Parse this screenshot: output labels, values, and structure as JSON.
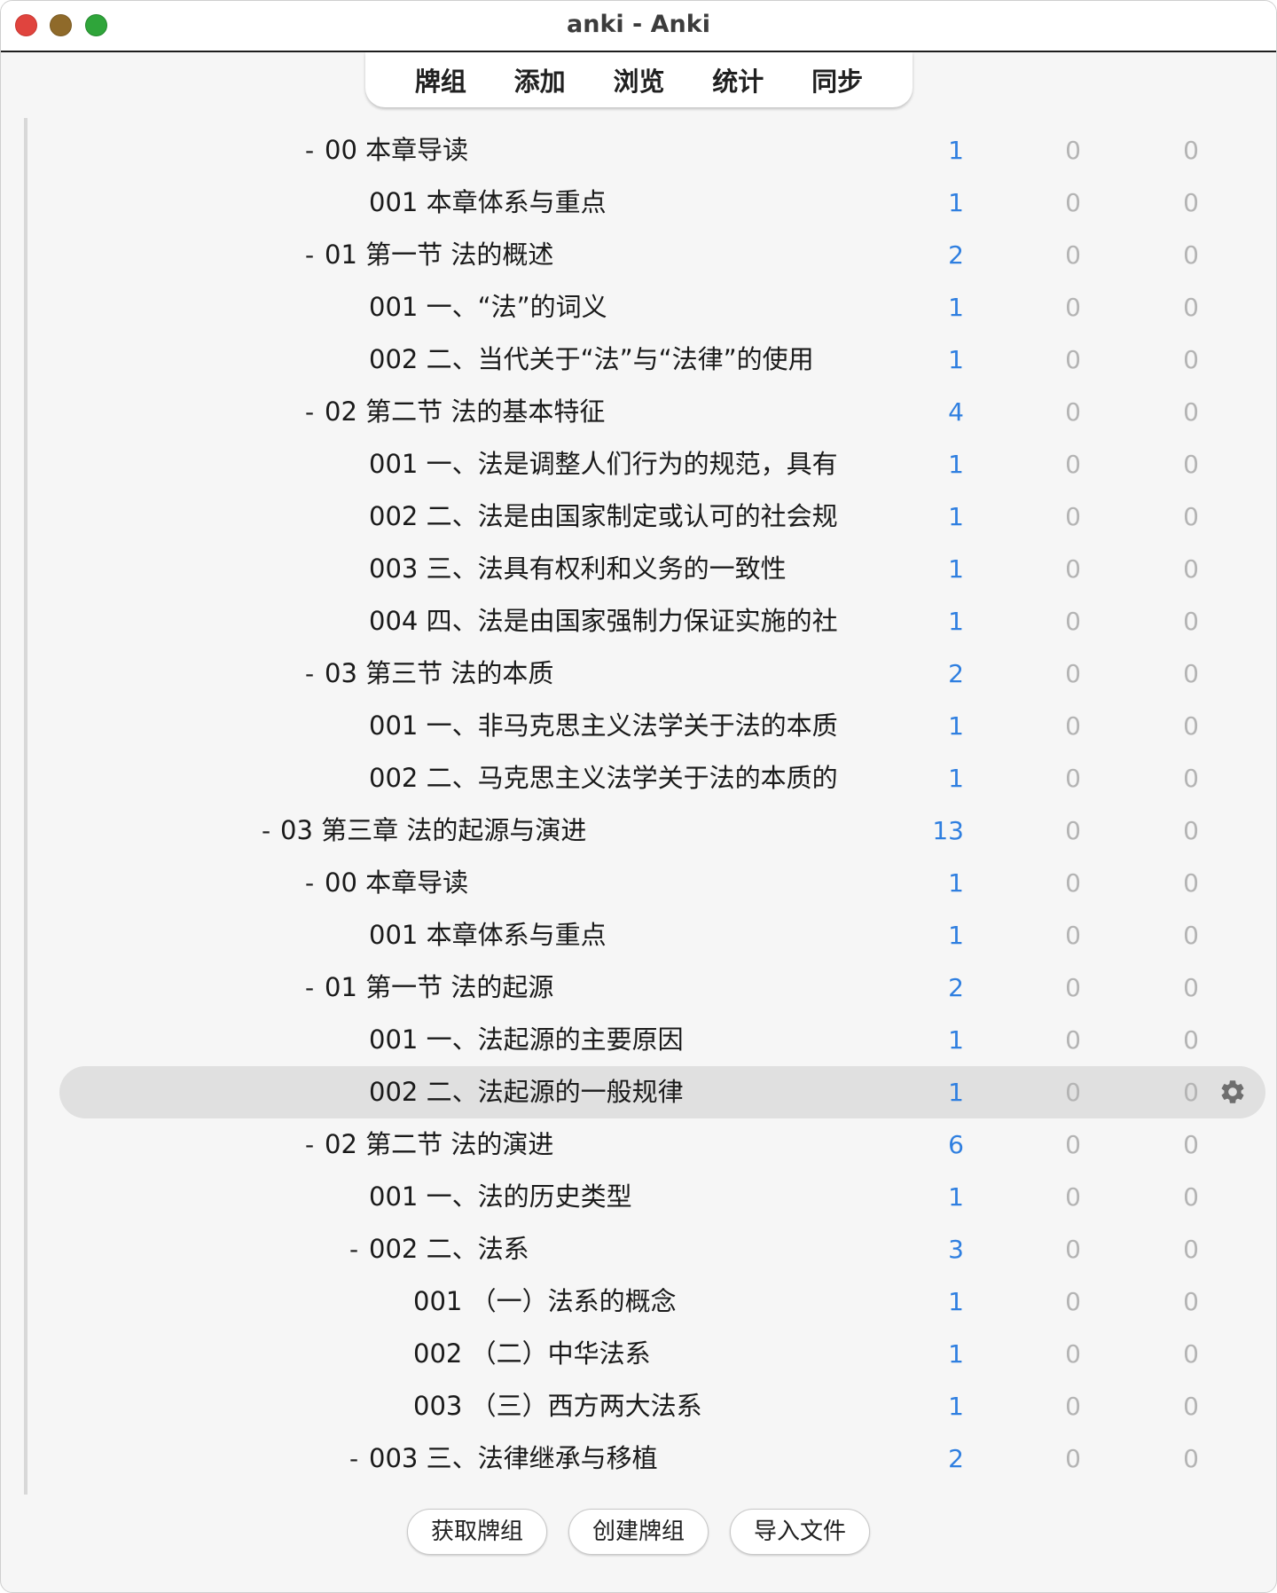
{
  "window": {
    "title": "anki - Anki"
  },
  "toolbar": {
    "tabs": [
      "牌组",
      "添加",
      "浏览",
      "统计",
      "同步"
    ]
  },
  "decks": [
    {
      "collapse": "-",
      "name": "00 本章导读",
      "level": 2,
      "new": "1",
      "learn": "0",
      "review": "0"
    },
    {
      "collapse": "",
      "name": "001 本章体系与重点",
      "level": 3,
      "new": "1",
      "learn": "0",
      "review": "0"
    },
    {
      "collapse": "-",
      "name": "01 第一节 法的概述",
      "level": 2,
      "new": "2",
      "learn": "0",
      "review": "0"
    },
    {
      "collapse": "",
      "name": "001 一、“法”的词义",
      "level": 3,
      "new": "1",
      "learn": "0",
      "review": "0"
    },
    {
      "collapse": "",
      "name": "002 二、当代关于“法”与“法律”的使用",
      "level": 3,
      "new": "1",
      "learn": "0",
      "review": "0"
    },
    {
      "collapse": "-",
      "name": "02 第二节 法的基本特征",
      "level": 2,
      "new": "4",
      "learn": "0",
      "review": "0"
    },
    {
      "collapse": "",
      "name": "001 一、法是调整人们行为的规范，具有",
      "level": 3,
      "new": "1",
      "learn": "0",
      "review": "0"
    },
    {
      "collapse": "",
      "name": "002 二、法是由国家制定或认可的社会规",
      "level": 3,
      "new": "1",
      "learn": "0",
      "review": "0"
    },
    {
      "collapse": "",
      "name": "003 三、法具有权利和义务的一致性",
      "level": 3,
      "new": "1",
      "learn": "0",
      "review": "0"
    },
    {
      "collapse": "",
      "name": "004 四、法是由国家强制力保证实施的社",
      "level": 3,
      "new": "1",
      "learn": "0",
      "review": "0"
    },
    {
      "collapse": "-",
      "name": "03 第三节 法的本质",
      "level": 2,
      "new": "2",
      "learn": "0",
      "review": "0"
    },
    {
      "collapse": "",
      "name": "001 一、非马克思主义法学关于法的本质",
      "level": 3,
      "new": "1",
      "learn": "0",
      "review": "0"
    },
    {
      "collapse": "",
      "name": "002 二、马克思主义法学关于法的本质的",
      "level": 3,
      "new": "1",
      "learn": "0",
      "review": "0"
    },
    {
      "collapse": "-",
      "name": "03 第三章 法的起源与演进",
      "level": 1,
      "new": "13",
      "learn": "0",
      "review": "0"
    },
    {
      "collapse": "-",
      "name": "00 本章导读",
      "level": 2,
      "new": "1",
      "learn": "0",
      "review": "0"
    },
    {
      "collapse": "",
      "name": "001 本章体系与重点",
      "level": 3,
      "new": "1",
      "learn": "0",
      "review": "0"
    },
    {
      "collapse": "-",
      "name": "01 第一节 法的起源",
      "level": 2,
      "new": "2",
      "learn": "0",
      "review": "0"
    },
    {
      "collapse": "",
      "name": "001 一、法起源的主要原因",
      "level": 3,
      "new": "1",
      "learn": "0",
      "review": "0"
    },
    {
      "collapse": "",
      "name": "002 二、法起源的一般规律",
      "level": 3,
      "new": "1",
      "learn": "0",
      "review": "0",
      "selected": true
    },
    {
      "collapse": "-",
      "name": "02 第二节 法的演进",
      "level": 2,
      "new": "6",
      "learn": "0",
      "review": "0"
    },
    {
      "collapse": "",
      "name": "001 一、法的历史类型",
      "level": 3,
      "new": "1",
      "learn": "0",
      "review": "0"
    },
    {
      "collapse": "-",
      "name": "002 二、法系",
      "level": 3,
      "new": "3",
      "learn": "0",
      "review": "0"
    },
    {
      "collapse": "",
      "name": "001 （一）法系的概念",
      "level": 4,
      "new": "1",
      "learn": "0",
      "review": "0"
    },
    {
      "collapse": "",
      "name": "002 （二）中华法系",
      "level": 4,
      "new": "1",
      "learn": "0",
      "review": "0"
    },
    {
      "collapse": "",
      "name": "003 （三）西方两大法系",
      "level": 4,
      "new": "1",
      "learn": "0",
      "review": "0"
    },
    {
      "collapse": "-",
      "name": "003 三、法律继承与移植",
      "level": 3,
      "new": "2",
      "learn": "0",
      "review": "0"
    }
  ],
  "icons": {
    "options": "gear-icon"
  },
  "bottom_buttons": [
    "获取牌组",
    "创建牌组",
    "导入文件"
  ],
  "colors": {
    "new_count": "#2f7fe0",
    "zero_count": "#b4b4b4",
    "selected_row": "#e0e0e0",
    "close": "#e0443e",
    "minimize": "#8f6a2a",
    "maximize": "#2fa53a"
  }
}
